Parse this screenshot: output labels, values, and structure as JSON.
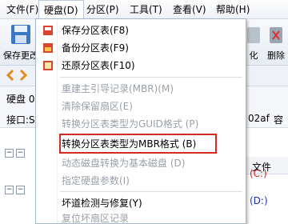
{
  "menubar": {
    "file": "文件(F)",
    "disk": "硬盘(D)",
    "partition": "分区(P)",
    "tools": "工具(T)",
    "view": "查看(V)",
    "help": "帮助(H)"
  },
  "toolbar": {
    "save_label": "保存更改",
    "right1_label": "化",
    "right2_label": "删除"
  },
  "disk_info": {
    "disk_label": "硬盘 0",
    "interface_label": "接口:S",
    "serial_fragment": "02af",
    "right_fragment": "容"
  },
  "tree": {
    "file_header": "文件",
    "drive_c": "(C:)",
    "drive_d": "(D:)"
  },
  "dropdown": {
    "items": [
      {
        "label": "保存分区表(F8)",
        "icon": "save-table-icon",
        "enabled": true
      },
      {
        "label": "备份分区表(F9)",
        "icon": "backup-table-icon",
        "enabled": true
      },
      {
        "label": "还原分区表(F10)",
        "icon": "restore-table-icon",
        "enabled": true
      },
      {
        "label": "重建主引导记录(MBR)(M)",
        "enabled": false
      },
      {
        "label": "清除保留扇区(E)",
        "enabled": false
      },
      {
        "label": "转换分区表类型为GUID格式 (P)",
        "enabled": false
      },
      {
        "label": "转换分区表类型为MBR格式 (B)",
        "enabled": true
      },
      {
        "label": "动态磁盘转换为基本磁盘 (D)",
        "enabled": false
      },
      {
        "label": "指定硬盘参数(I)",
        "enabled": false
      },
      {
        "label": "坏道检测与修复(Y)",
        "enabled": true
      },
      {
        "label": "复位坏扇区记录",
        "enabled": false
      }
    ]
  },
  "colors": {
    "highlight_border": "#d42b20",
    "drive_text": "#c81e1e",
    "drive_d_text": "#1e2fb4"
  }
}
